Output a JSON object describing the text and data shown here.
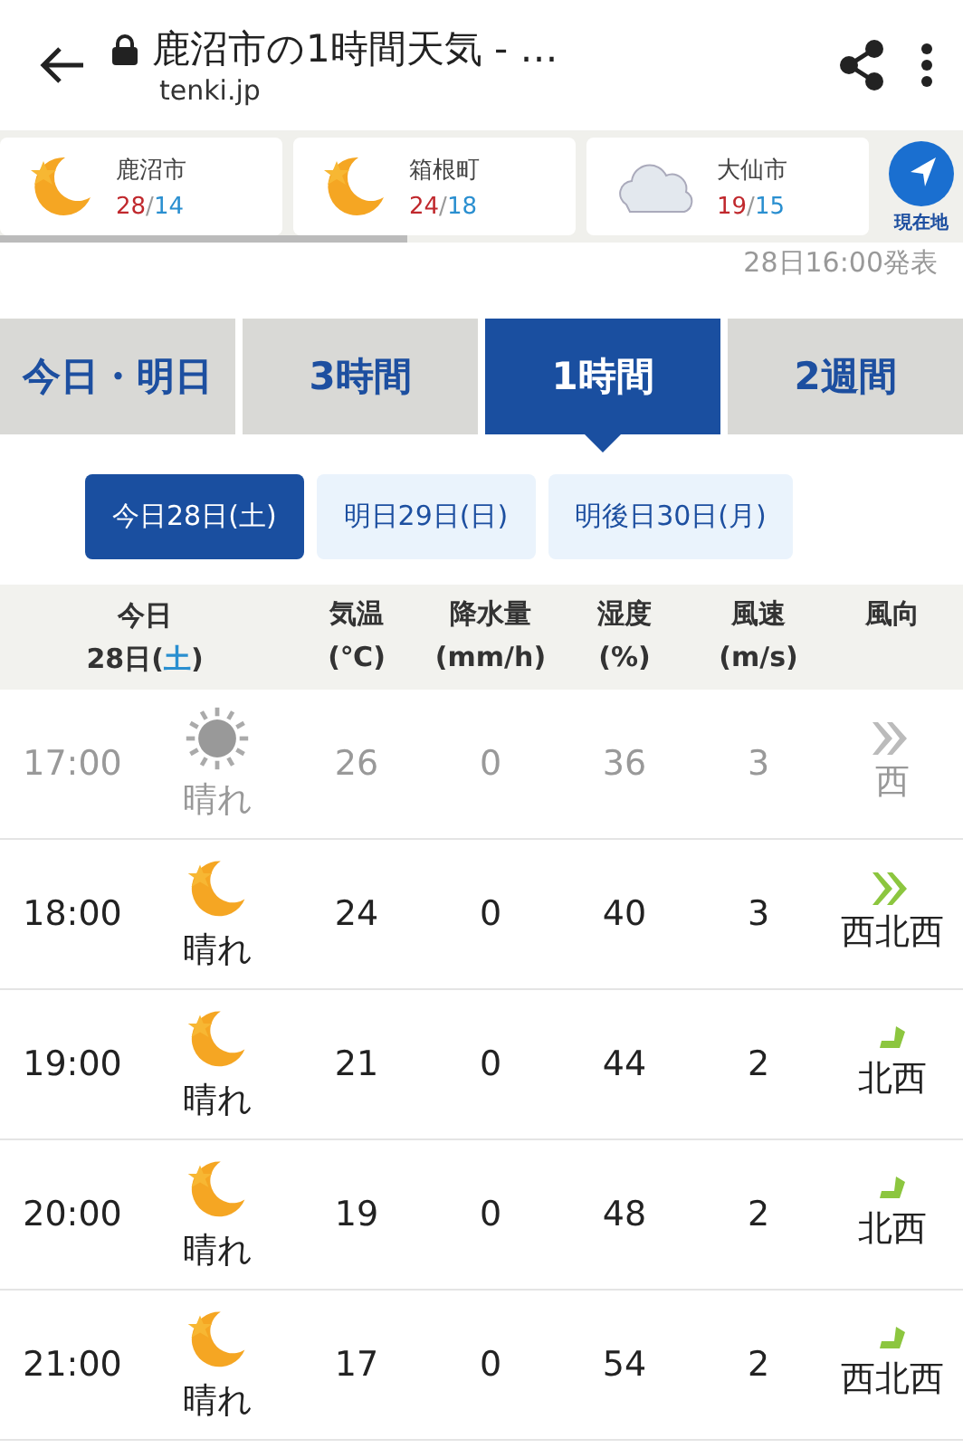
{
  "browser_bar": {
    "title": "鹿沼市の1時間天気 - …",
    "url": "tenki.jp"
  },
  "cities": [
    {
      "name": "鹿沼市",
      "high": "28",
      "separator": "/",
      "low": "14",
      "kind": "moon"
    },
    {
      "name": "箱根町",
      "high": "24",
      "separator": "/",
      "low": "18",
      "kind": "moon"
    },
    {
      "name": "大仙市",
      "high": "19",
      "separator": "/",
      "low": "15",
      "kind": "cloud"
    }
  ],
  "location_button": "現在地",
  "issued": "28日16:00発表",
  "tabs": [
    {
      "label": "今日・明日",
      "selected": false
    },
    {
      "label": "3時間",
      "selected": false
    },
    {
      "label": "1時間",
      "selected": true
    },
    {
      "label": "2週間",
      "selected": false
    }
  ],
  "days": [
    {
      "label": "今日28日(土)",
      "selected": true
    },
    {
      "label": "明日29日(日)",
      "selected": false
    },
    {
      "label": "明後日30日(月)",
      "selected": false
    }
  ],
  "table": {
    "day_heading": {
      "top": "今日",
      "date": "28日(",
      "weekday": "土",
      "close": ")"
    },
    "columns": [
      {
        "label": "気温",
        "unit": "(℃)"
      },
      {
        "label": "降水量",
        "unit": "(mm/h)"
      },
      {
        "label": "湿度",
        "unit": "(%)"
      },
      {
        "label": "風速",
        "unit": "(m/s)"
      },
      {
        "label": "風向"
      }
    ],
    "rows": [
      {
        "time": "17:00",
        "kind": "sun",
        "weather": "晴れ",
        "temp": "26",
        "rain": "0",
        "humidity": "36",
        "wind": "3",
        "wind_arrow": {
          "kind": "double"
        },
        "direction": "西",
        "past": true
      },
      {
        "time": "18:00",
        "kind": "moon",
        "weather": "晴れ",
        "temp": "24",
        "rain": "0",
        "humidity": "40",
        "wind": "3",
        "wind_arrow": {
          "kind": "double"
        },
        "direction": "西北西",
        "past": false
      },
      {
        "time": "19:00",
        "kind": "moon",
        "weather": "晴れ",
        "temp": "21",
        "rain": "0",
        "humidity": "44",
        "wind": "2",
        "wind_arrow": {
          "kind": "single"
        },
        "direction": "北西",
        "past": false
      },
      {
        "time": "20:00",
        "kind": "moon",
        "weather": "晴れ",
        "temp": "19",
        "rain": "0",
        "humidity": "48",
        "wind": "2",
        "wind_arrow": {
          "kind": "single"
        },
        "direction": "北西",
        "past": false
      },
      {
        "time": "21:00",
        "kind": "moon",
        "weather": "晴れ",
        "temp": "17",
        "rain": "0",
        "humidity": "54",
        "wind": "2",
        "wind_arrow": {
          "kind": "single"
        },
        "direction": "西北西",
        "past": false
      }
    ]
  }
}
